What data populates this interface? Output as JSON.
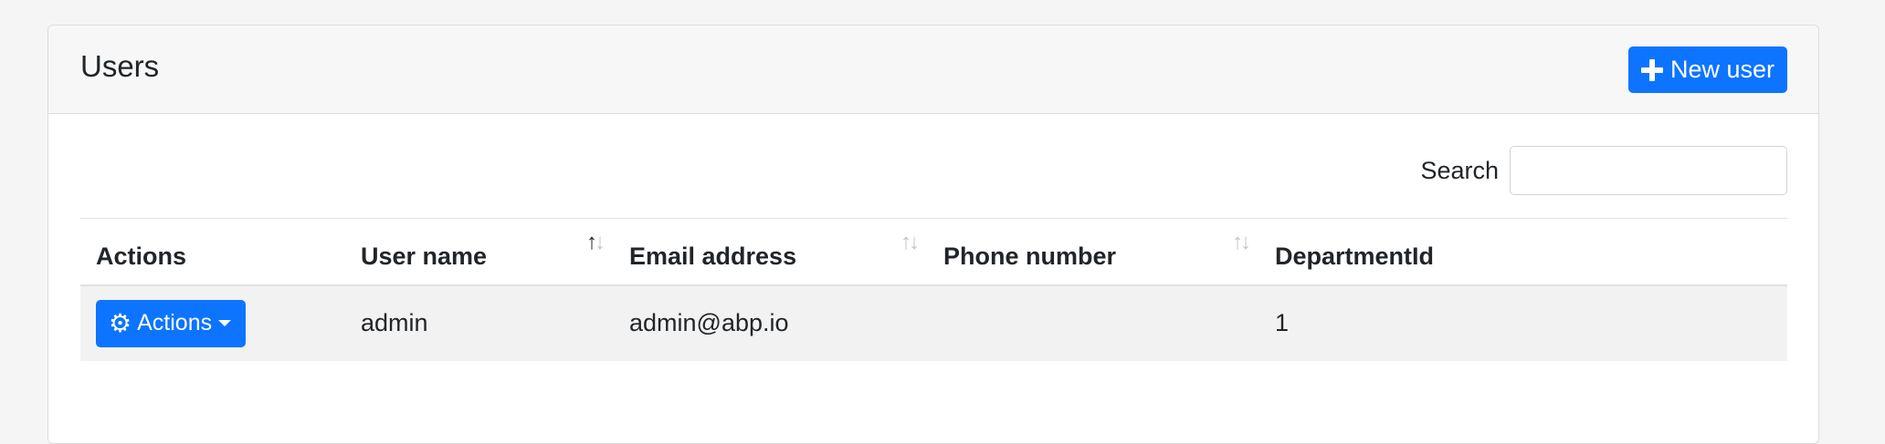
{
  "header": {
    "title": "Users",
    "new_user_label": "New user"
  },
  "search": {
    "label": "Search",
    "value": "",
    "placeholder": ""
  },
  "table": {
    "columns": [
      {
        "label": "Actions",
        "sortable": false
      },
      {
        "label": "User name",
        "sortable": true,
        "sort": "ascending"
      },
      {
        "label": "Email address",
        "sortable": true,
        "sort": "none"
      },
      {
        "label": "Phone number",
        "sortable": true,
        "sort": "none"
      },
      {
        "label": "DepartmentId",
        "sortable": false
      }
    ],
    "rows": [
      {
        "actions_label": "Actions",
        "user_name": "admin",
        "email": "admin@abp.io",
        "phone": "",
        "department_id": "1"
      }
    ]
  },
  "colors": {
    "primary": "#0d74ff",
    "header_bg": "#f7f7f7",
    "row_bg": "#f2f2f2"
  },
  "icons": {
    "new_user": "plus-icon",
    "actions": "gear-icon",
    "dropdown": "caret-down-icon",
    "sort": "sort-arrows-icon"
  }
}
